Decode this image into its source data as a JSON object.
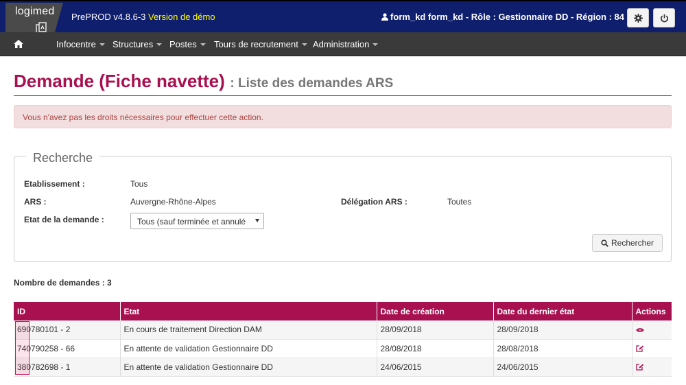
{
  "header": {
    "logo_text": "logimed",
    "app_name": "PrePROD v4.8.6-3",
    "demo_label": "Version de démo",
    "user_info": "form_kd form_kd - Rôle : Gestionnaire DD - Région : 84",
    "icons": [
      "user-icon",
      "gear-icon",
      "power-icon"
    ]
  },
  "nav": {
    "home_icon": "home-icon",
    "items": [
      {
        "label": "Infocentre"
      },
      {
        "label": "Structures"
      },
      {
        "label": "Postes"
      },
      {
        "label": "Tours de recrutement"
      },
      {
        "label": "Administration"
      }
    ]
  },
  "page": {
    "title": "Demande (Fiche navette)",
    "subtitle": ": Liste des demandes ARS",
    "alert": "Vous n'avez pas les droits nécessaires pour effectuer cette action."
  },
  "search": {
    "legend": "Recherche",
    "etablissement_label": "Etablissement :",
    "etablissement_value": "Tous",
    "ars_label": "ARS :",
    "ars_value": "Auvergne-Rhône-Alpes",
    "delegation_label": "Délégation ARS :",
    "delegation_value": "Toutes",
    "etat_label": "Etat de la demande :",
    "etat_selected": "Tous (sauf terminée et annulé",
    "button_label": "Rechercher"
  },
  "results": {
    "count_label": "Nombre de demandes : 3",
    "columns": [
      "ID",
      "Etat",
      "Date de création",
      "Date du dernier état",
      "Actions"
    ],
    "rows": [
      {
        "id": "690780101 - 2",
        "etat": "En cours de traitement Direction DAM",
        "date_creation": "28/09/2018",
        "date_dernier_etat": "28/09/2018",
        "action": "view-icon"
      },
      {
        "id": "740790258 - 66",
        "etat": "En attente de validation Gestionnaire DD",
        "date_creation": "28/08/2018",
        "date_dernier_etat": "28/08/2018",
        "action": "edit-icon"
      },
      {
        "id": "380782698 - 1",
        "etat": "En attente de validation Gestionnaire DD",
        "date_creation": "24/06/2015",
        "date_dernier_etat": "24/06/2015",
        "action": "edit-icon"
      }
    ]
  },
  "colors": {
    "brand": "#a8104f",
    "topbar": "#0f1f6e",
    "navbar": "#3a3a3a",
    "demo": "#ffff00"
  }
}
